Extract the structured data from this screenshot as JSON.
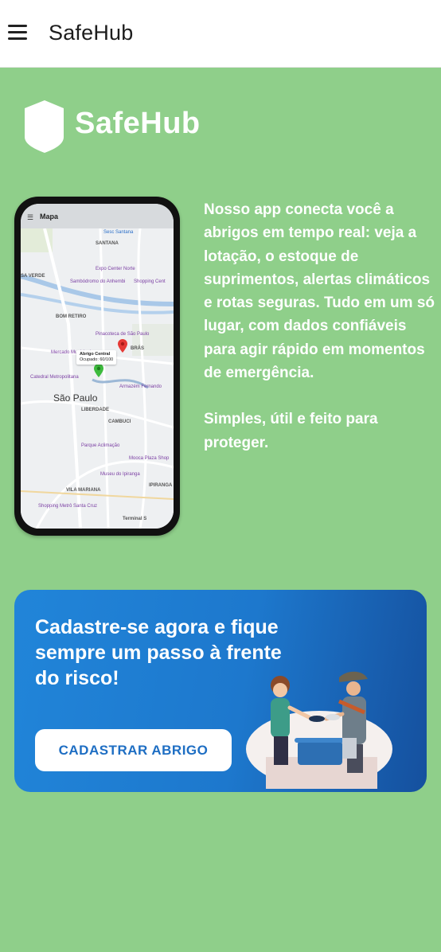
{
  "app": {
    "title": "SafeHub"
  },
  "brand": {
    "name": "SafeHub"
  },
  "phone": {
    "screen_title": "Mapa",
    "map_labels": {
      "santana": "SANTANA",
      "casa_verde": "SA VERDE",
      "bom_retiro": "BOM RETIRO",
      "bras": "BRÁS",
      "sao_paulo": "São Paulo",
      "liberdade": "LIBERDADE",
      "cambuci": "CAMBUCI",
      "vila_mariana": "VILA MARIANA",
      "ipiranga": "IPIRANGA",
      "expo_center": "Expo Center Norte",
      "shopping": "Shopping Cent",
      "sambodromo": "Sambódromo do Anhembi",
      "pinacoteca": "Pinacoteca de São Paulo",
      "mercado": "Mercado Municipal",
      "catedral": "Catedral Metropolitana",
      "armazem": "Armazém Fernando",
      "parque_aclimacao": "Parque Aclimação",
      "museu": "Museu do Ipiranga",
      "shopping_metro": "Shopping Metrô Santa Cruz",
      "terminal": "Terminal S",
      "mooca": "Mooca Plaza Shop",
      "sesc": "Sesc Santana"
    },
    "popup": {
      "name": "Abrigo Central",
      "occupancy": "Ocupado: 60/100"
    }
  },
  "description": {
    "paragraph1": "Nosso app conecta você a abrigos em tempo real: veja a lotação, o estoque de suprimentos, alertas climáticos e rotas seguras. Tudo em um só lugar, com dados confiáveis para agir rápido em momentos de emergência.",
    "paragraph2": "Simples, útil e feito para proteger."
  },
  "banner": {
    "title": "Cadastre-se agora e fique sempre um passo à frente do risco!",
    "button_label": "CADASTRAR ABRIGO"
  },
  "colors": {
    "background": "#8fcf8a",
    "banner_start": "#2185d9",
    "banner_end": "#15509e",
    "button_text": "#1e6ec3"
  },
  "icons": {
    "menu": "hamburger-menu-icon",
    "logo": "shield-icon",
    "map_pin_red": "map-pin-icon",
    "map_pin_green": "map-pin-icon"
  }
}
